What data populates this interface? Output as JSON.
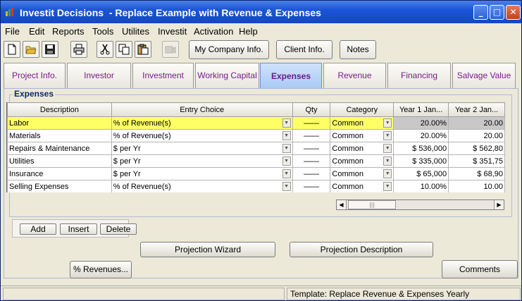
{
  "window": {
    "app_name": "Investit Decisions",
    "document_title": "- Replace Example with Revenue & Expenses"
  },
  "menu": [
    "File",
    "Edit",
    "Reports",
    "Tools",
    "Utilites",
    "Investit",
    "Activation",
    "Help"
  ],
  "toolbar": {
    "icons": [
      "new-file-icon",
      "open-folder-icon",
      "save-icon",
      "print-icon",
      "cut-icon",
      "copy-icon",
      "paste-icon",
      "camera-icon"
    ],
    "my_company": "My Company Info.",
    "client_info": "Client Info.",
    "notes": "Notes"
  },
  "tabs": [
    {
      "label": "Project Info."
    },
    {
      "label": "Investor"
    },
    {
      "label": "Investment"
    },
    {
      "label": "Working Capital"
    },
    {
      "label": "Expenses",
      "active": true
    },
    {
      "label": "Revenue"
    },
    {
      "label": "Financing"
    },
    {
      "label": "Salvage Value"
    }
  ],
  "expenses": {
    "legend": "Expenses",
    "columns": [
      "Description",
      "Entry Choice",
      "Qty",
      "Category",
      "Year 1 Jan...",
      "Year 2 Jan..."
    ],
    "rows": [
      {
        "description": "Labor",
        "entry": "% of Revenue(s)",
        "qty": "——",
        "category": "Common",
        "y1": "20.00%",
        "y2": "20.00"
      },
      {
        "description": "Materials",
        "entry": "% of Revenue(s)",
        "qty": "——",
        "category": "Common",
        "y1": "20.00%",
        "y2": "20.00"
      },
      {
        "description": "Repairs & Maintenance",
        "entry": "$ per Yr",
        "qty": "——",
        "category": "Common",
        "y1": "$ 536,000",
        "y2": "$ 562,80"
      },
      {
        "description": "Utilities",
        "entry": "$ per Yr",
        "qty": "——",
        "category": "Common",
        "y1": "$ 335,000",
        "y2": "$ 351,75"
      },
      {
        "description": "Insurance",
        "entry": "$ per Yr",
        "qty": "——",
        "category": "Common",
        "y1": "$ 65,000",
        "y2": "$ 68,90"
      },
      {
        "description": "Selling Expenses",
        "entry": "% of Revenue(s)",
        "qty": "——",
        "category": "Common",
        "y1": "10.00%",
        "y2": "10.00"
      }
    ]
  },
  "row_actions": {
    "add": "Add",
    "insert": "Insert",
    "delete": "Delete"
  },
  "buttons": {
    "projection_wizard": "Projection Wizard",
    "projection_description": "Projection Description",
    "pct_revenues": "% Revenues...",
    "comments": "Comments"
  },
  "status": {
    "template": "Template: Replace Revenue & Expenses Yearly"
  }
}
